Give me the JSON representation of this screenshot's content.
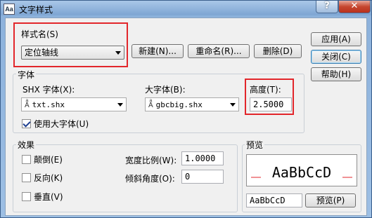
{
  "window": {
    "title": "文字样式",
    "app_icon": "Aa",
    "help_glyph": "?",
    "close_glyph": "✕"
  },
  "style_name": {
    "label": "样式名(S)",
    "selected": "定位轴线"
  },
  "buttons": {
    "new": "新建(N)...",
    "rename": "重命名(R)...",
    "delete": "删除(D)",
    "apply": "应用(A)",
    "close": "关闭(C)",
    "help": "帮助(H)",
    "preview": "预览(P)"
  },
  "font": {
    "group_label": "字体",
    "shx_label": "SHX 字体(X):",
    "shx_value": "txt.shx",
    "bigfont_label": "大字体(B):",
    "bigfont_value": "gbcbig.shx",
    "height_label": "高度(T):",
    "height_value": "2.5000",
    "use_bigfont_label": "使用大字体(U)",
    "use_bigfont_checked": true,
    "font_icon": "font-icon"
  },
  "effects": {
    "group_label": "效果",
    "upside_down": {
      "label": "颠倒(E)",
      "checked": false
    },
    "backwards": {
      "label": "反向(K)",
      "checked": false
    },
    "vertical": {
      "label": "垂直(V)",
      "checked": false
    },
    "width_factor_label": "宽度比例(W):",
    "width_factor_value": "1.0000",
    "oblique_angle_label": "倾斜角度(O):",
    "oblique_angle_value": "0"
  },
  "preview": {
    "group_label": "预览",
    "sample_text": "AaBbCcD",
    "input_value": "AaBbCcD"
  },
  "colors": {
    "highlight": "#e2262b",
    "close_button": "#c6472f"
  }
}
